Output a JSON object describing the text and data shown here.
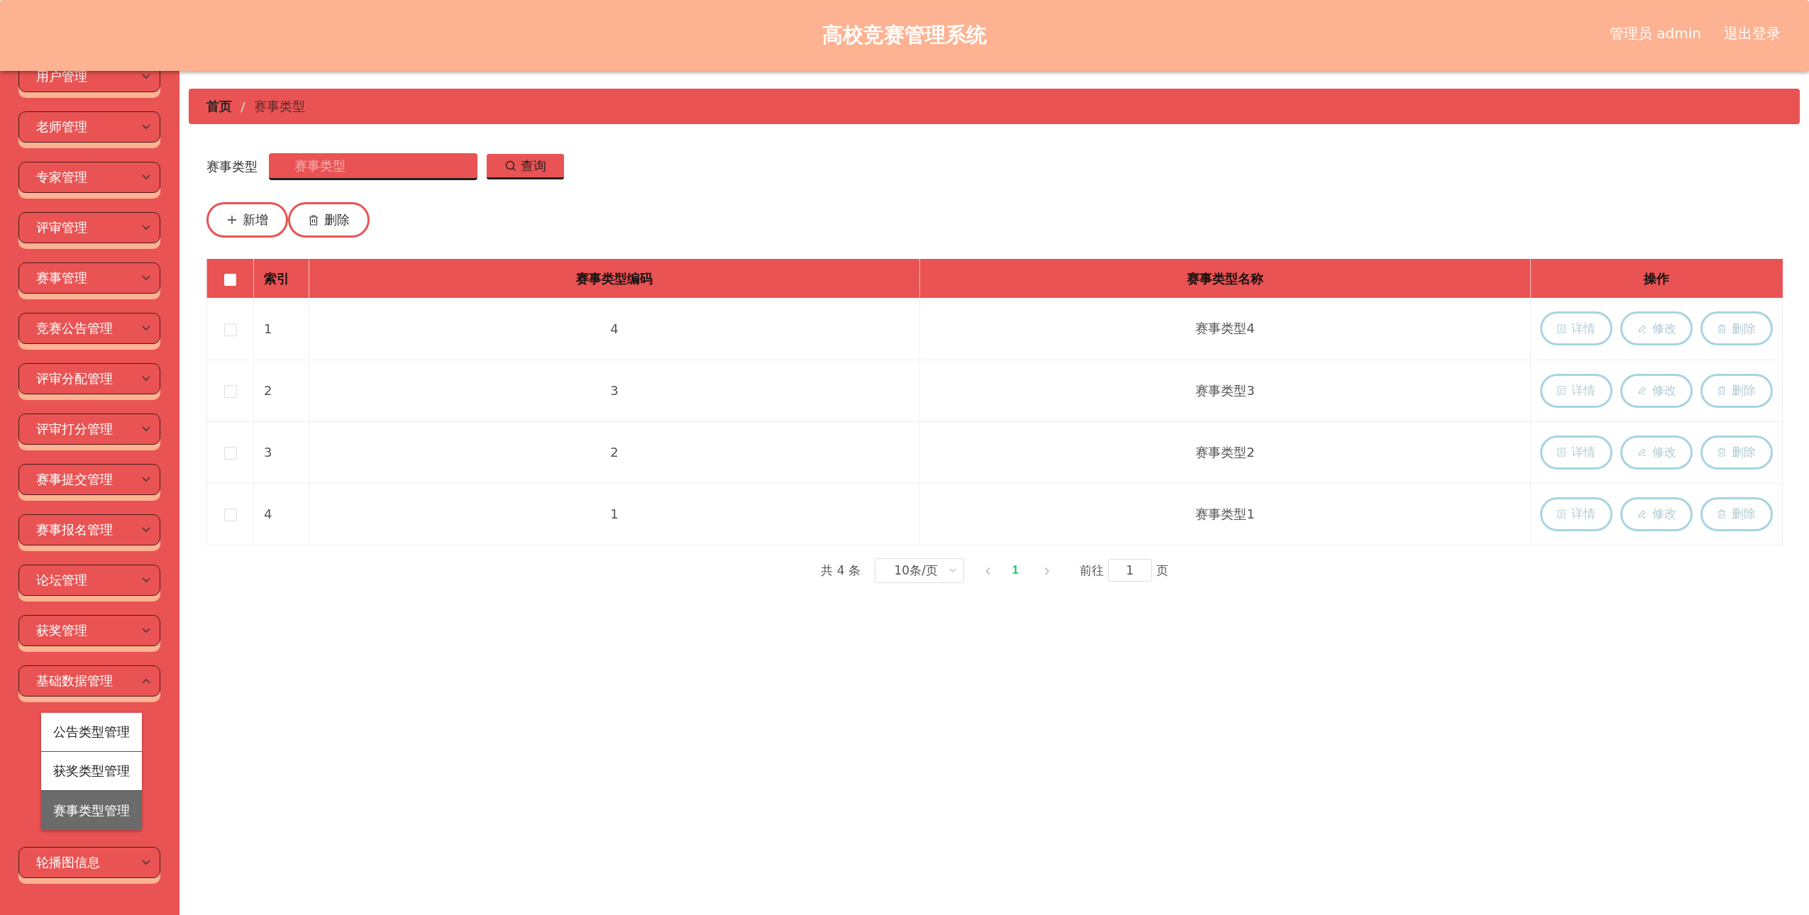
{
  "header": {
    "title": "高校竞赛管理系统",
    "user": "管理员 admin",
    "logout": "退出登录"
  },
  "sidebar": {
    "items": [
      {
        "label": "用户管理",
        "expanded": false
      },
      {
        "label": "老师管理",
        "expanded": false
      },
      {
        "label": "专家管理",
        "expanded": false
      },
      {
        "label": "评审管理",
        "expanded": false
      },
      {
        "label": "赛事管理",
        "expanded": false
      },
      {
        "label": "竞赛公告管理",
        "expanded": false
      },
      {
        "label": "评审分配管理",
        "expanded": false
      },
      {
        "label": "评审打分管理",
        "expanded": false
      },
      {
        "label": "赛事提交管理",
        "expanded": false
      },
      {
        "label": "赛事报名管理",
        "expanded": false
      },
      {
        "label": "论坛管理",
        "expanded": false
      },
      {
        "label": "获奖管理",
        "expanded": false
      },
      {
        "label": "基础数据管理",
        "expanded": true,
        "children": [
          {
            "label": "公告类型管理",
            "selected": false
          },
          {
            "label": "获奖类型管理",
            "selected": false
          },
          {
            "label": "赛事类型管理",
            "selected": true
          }
        ]
      },
      {
        "label": "轮播图信息",
        "expanded": false
      }
    ]
  },
  "breadcrumb": [
    "首页",
    "/",
    "赛事类型"
  ],
  "search": {
    "label": "赛事类型",
    "placeholder": "赛事类型",
    "button": "查询"
  },
  "actions": [
    "新增",
    "删除"
  ],
  "table": {
    "select_all": {
      "checked": false
    },
    "columns": [
      "索引",
      "赛事类型编码",
      "赛事类型名称",
      "操作"
    ],
    "rows": [
      {
        "checked": false,
        "index": "1",
        "code": "4",
        "name": "赛事类型4",
        "buttons": [
          "详情",
          "修改",
          "删除"
        ]
      },
      {
        "checked": false,
        "index": "2",
        "code": "3",
        "name": "赛事类型3",
        "buttons": [
          "详情",
          "修改",
          "删除"
        ]
      },
      {
        "checked": false,
        "index": "3",
        "code": "2",
        "name": "赛事类型2",
        "buttons": [
          "详情",
          "修改",
          "删除"
        ]
      },
      {
        "checked": false,
        "index": "4",
        "code": "1",
        "name": "赛事类型1",
        "buttons": [
          "详情",
          "修改",
          "删除"
        ]
      }
    ]
  },
  "pagination": {
    "total": "共 4 条",
    "page_size": "10条/页",
    "prev": "‹",
    "pages": [
      {
        "label": "1",
        "selected": true
      }
    ],
    "next": "›",
    "goto_label": "前往",
    "goto_value": "1",
    "goto_suffix": "页"
  }
}
